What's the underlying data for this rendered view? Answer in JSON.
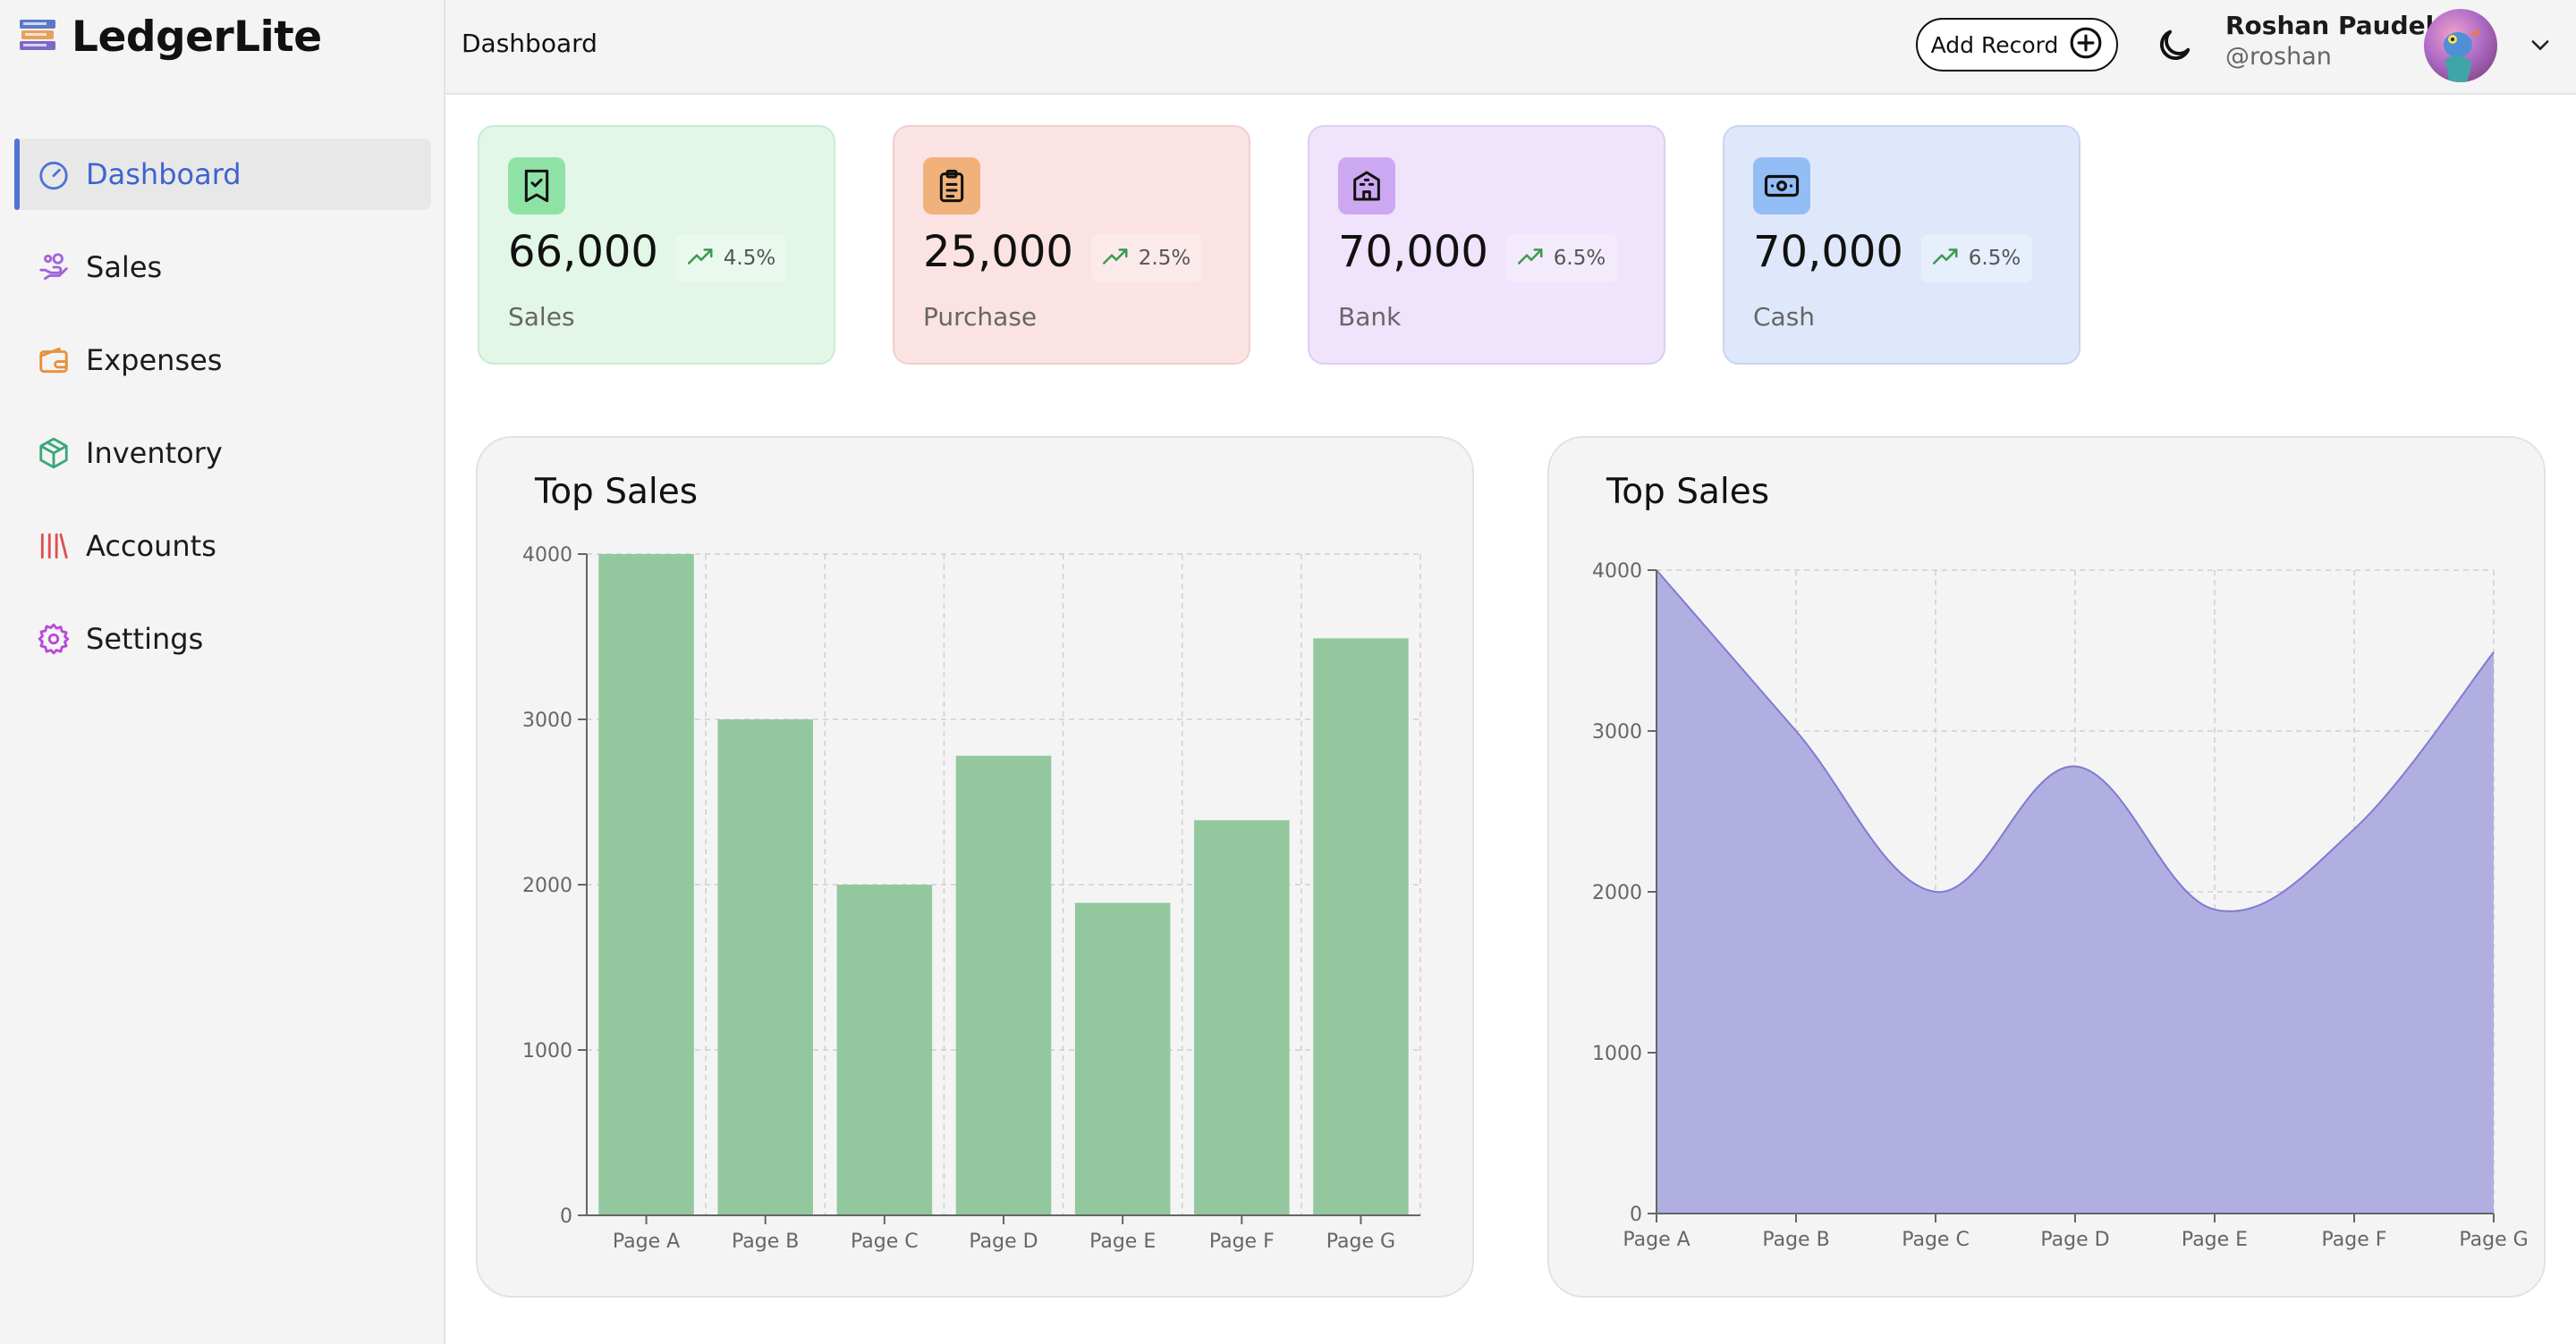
{
  "app": {
    "name": "LedgerLite"
  },
  "sidebar": {
    "items": [
      {
        "label": "Dashboard",
        "icon": "gauge-icon",
        "active": true
      },
      {
        "label": "Sales",
        "icon": "hand-coins-icon"
      },
      {
        "label": "Expenses",
        "icon": "wallet-icon"
      },
      {
        "label": "Inventory",
        "icon": "box-icon"
      },
      {
        "label": "Accounts",
        "icon": "library-icon"
      },
      {
        "label": "Settings",
        "icon": "gear-icon"
      }
    ]
  },
  "header": {
    "title": "Dashboard",
    "add_record_label": "Add Record",
    "user": {
      "name": "Roshan Paudel",
      "handle": "@roshan"
    }
  },
  "cards": [
    {
      "value": "66,000",
      "trend": "4.5%",
      "label": "Sales",
      "bg": "#e2f7e7",
      "border": "#c9ebd2",
      "icon_bg": "#8fe2a5",
      "icon": "receipt-icon"
    },
    {
      "value": "25,000",
      "trend": "2.5%",
      "label": "Purchase",
      "bg": "#fbe3e3",
      "border": "#f0cfcf",
      "icon_bg": "#f0b27a",
      "icon": "clipboard-icon"
    },
    {
      "value": "70,000",
      "trend": "6.5%",
      "label": "Bank",
      "bg": "#efe4fb",
      "border": "#decdf2",
      "icon_bg": "#cda8f2",
      "icon": "bank-icon"
    },
    {
      "value": "70,000",
      "trend": "6.5%",
      "label": "Cash",
      "bg": "#dfe8fb",
      "border": "#c8d6f2",
      "icon_bg": "#93bdf5",
      "icon": "banknote-icon"
    }
  ],
  "charts": {
    "bar_title": "Top Sales",
    "area_title": "Top Sales"
  },
  "chart_data": [
    {
      "type": "bar",
      "title": "Top Sales",
      "categories": [
        "Page A",
        "Page B",
        "Page C",
        "Page D",
        "Page E",
        "Page F",
        "Page G"
      ],
      "values": [
        4000,
        3000,
        2000,
        2780,
        1890,
        2390,
        3490
      ],
      "ylim": [
        0,
        4000
      ],
      "yticks": [
        0,
        1000,
        2000,
        3000,
        4000
      ],
      "grid": true,
      "color": "#93c89e"
    },
    {
      "type": "area",
      "title": "Top Sales",
      "categories": [
        "Page A",
        "Page B",
        "Page C",
        "Page D",
        "Page E",
        "Page F",
        "Page G"
      ],
      "values": [
        4000,
        3000,
        2000,
        2780,
        1890,
        2390,
        3490
      ],
      "ylim": [
        0,
        4000
      ],
      "yticks": [
        0,
        1000,
        2000,
        3000,
        4000
      ],
      "grid": true,
      "color": "#b1aee2",
      "stroke": "#7f7bd0"
    }
  ]
}
